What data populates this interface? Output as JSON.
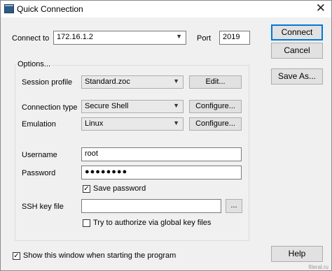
{
  "window": {
    "title": "Quick Connection",
    "close_glyph": "✕"
  },
  "connection": {
    "connect_to_label": "Connect to",
    "host_value": "172.16.1.2",
    "port_label": "Port",
    "port_value": "2019"
  },
  "options": {
    "group_title": "Options...",
    "session_profile_label": "Session profile",
    "session_profile_value": "Standard.zoc",
    "edit_button": "Edit...",
    "connection_type_label": "Connection type",
    "connection_type_value": "Secure Shell",
    "configure_button_1": "Configure...",
    "emulation_label": "Emulation",
    "emulation_value": "Linux",
    "configure_button_2": "Configure...",
    "username_label": "Username",
    "username_value": "root",
    "password_label": "Password",
    "password_value": "●●●●●●●●",
    "save_password_label": "Save password",
    "save_password_checked": true,
    "ssh_key_label": "SSH key file",
    "ssh_key_value": "",
    "browse_button": "...",
    "global_key_label": "Try to authorize via global key files",
    "global_key_checked": false
  },
  "buttons": {
    "connect": "Connect",
    "cancel": "Cancel",
    "save_as": "Save As...",
    "help": "Help"
  },
  "footer": {
    "show_window_label": "Show this window when starting the program",
    "show_window_checked": true
  },
  "icons": {
    "app_icon": "terminal-icon",
    "dropdown": "chevron-down-icon",
    "check": "checkmark-icon"
  },
  "watermark": "fileral.ru"
}
